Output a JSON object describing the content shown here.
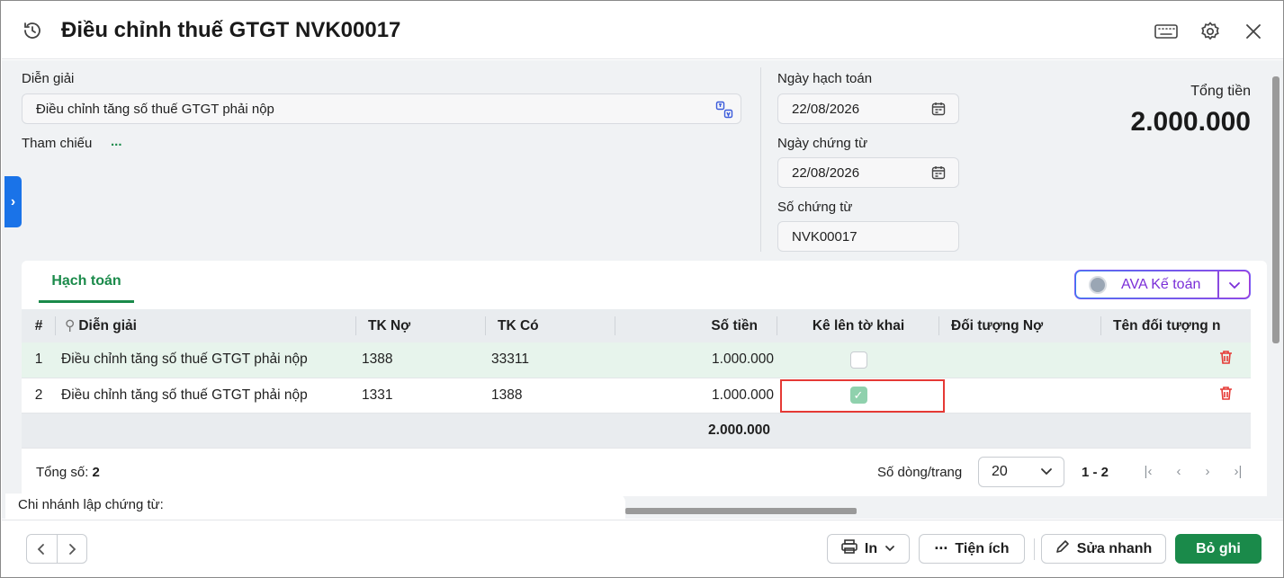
{
  "header": {
    "title": "Điều chỉnh thuế GTGT NVK00017"
  },
  "form": {
    "dien_giai_label": "Diễn giải",
    "dien_giai_value": "Điều chỉnh tăng số thuế GTGT phải nộp",
    "tham_chieu_label": "Tham chiếu",
    "tham_chieu_value": "...",
    "ngay_hach_toan_label": "Ngày hạch toán",
    "ngay_hach_toan_value": "22/08/2026",
    "ngay_chung_tu_label": "Ngày chứng từ",
    "ngay_chung_tu_value": "22/08/2026",
    "so_chung_tu_label": "Số chứng từ",
    "so_chung_tu_value": "NVK00017",
    "tong_tien_label": "Tổng tiền",
    "tong_tien_value": "2.000.000"
  },
  "tabs": {
    "active": "Hạch toán"
  },
  "ava": {
    "label": "AVA Kế toán"
  },
  "table": {
    "columns": {
      "index": "#",
      "dien_giai": "Diễn giải",
      "tk_no": "TK Nợ",
      "tk_co": "TK Có",
      "so_tien": "Số tiền",
      "ke_len_to_khai": "Kê lên tờ khai",
      "doi_tuong_no": "Đối tượng Nợ",
      "ten_doi_tuong": "Tên đối tượng n"
    },
    "rows": [
      {
        "index": "1",
        "dien_giai": "Điều chỉnh tăng số thuế GTGT phải nộp",
        "tk_no": "1388",
        "tk_co": "33311",
        "so_tien": "1.000.000",
        "checked": false
      },
      {
        "index": "2",
        "dien_giai": "Điều chỉnh tăng số thuế GTGT phải nộp",
        "tk_no": "1331",
        "tk_co": "1388",
        "so_tien": "1.000.000",
        "checked": true
      }
    ],
    "total": "2.000.000"
  },
  "pagination": {
    "count_label": "Tổng số:",
    "count_value": "2",
    "rows_label": "Số dòng/trang",
    "rows_value": "20",
    "range": "1 - 2"
  },
  "branch": {
    "label": "Chi nhánh lập chứng từ:"
  },
  "footer": {
    "print_label": "In",
    "utility_label": "Tiện ích",
    "quick_edit_label": "Sửa nhanh",
    "save_label": "Bỏ ghi"
  }
}
